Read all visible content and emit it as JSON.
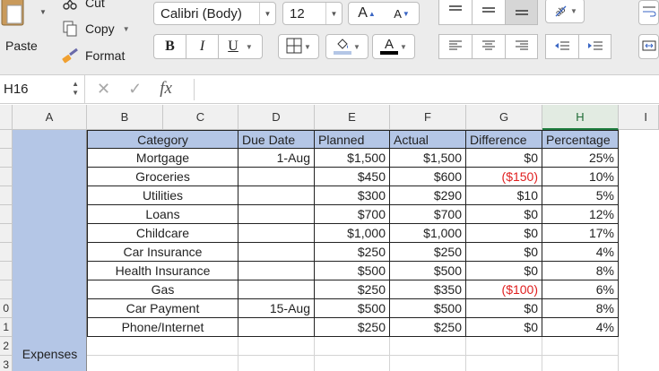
{
  "ribbon": {
    "paste_label": "Paste",
    "cut_label": "Cut",
    "copy_label": "Copy",
    "format_label": "Format",
    "font_name": "Calibri (Body)",
    "font_size": "12",
    "bold": "B",
    "italic": "I",
    "underline": "U",
    "grow_font": "A",
    "shrink_font": "A",
    "font_color_letter": "A",
    "font_color": "#000000",
    "fill_color": "#b4c6e6",
    "icons": [
      "paste-clipboard",
      "scissors",
      "copy-pages",
      "format-painter",
      "borders-grid",
      "fill-bucket",
      "orientation",
      "indent-decrease",
      "indent-increase",
      "wrap-text",
      "merge-center"
    ]
  },
  "formula_bar": {
    "name_box": "H16",
    "fx": "fx",
    "formula": ""
  },
  "columns": [
    "A",
    "B",
    "C",
    "D",
    "E",
    "F",
    "G",
    "H",
    "I"
  ],
  "selected_column": "H",
  "row_numbers": [
    "",
    "",
    "",
    "",
    "",
    "",
    "",
    "",
    "",
    "0",
    "1",
    "2",
    "3"
  ],
  "table": {
    "headers": {
      "category": "Category",
      "due_date": "Due Date",
      "planned": "Planned",
      "actual": "Actual",
      "difference": "Difference",
      "percentage": "Percentage"
    },
    "rows": [
      {
        "category": "Mortgage",
        "due": "1-Aug",
        "planned": "$1,500",
        "actual": "$1,500",
        "diff": "$0",
        "pct": "25%",
        "neg": false
      },
      {
        "category": "Groceries",
        "due": "",
        "planned": "$450",
        "actual": "$600",
        "diff": "($150)",
        "pct": "10%",
        "neg": true
      },
      {
        "category": "Utilities",
        "due": "",
        "planned": "$300",
        "actual": "$290",
        "diff": "$10",
        "pct": "5%",
        "neg": false
      },
      {
        "category": "Loans",
        "due": "",
        "planned": "$700",
        "actual": "$700",
        "diff": "$0",
        "pct": "12%",
        "neg": false
      },
      {
        "category": "Childcare",
        "due": "",
        "planned": "$1,000",
        "actual": "$1,000",
        "diff": "$0",
        "pct": "17%",
        "neg": false
      },
      {
        "category": "Car Insurance",
        "due": "",
        "planned": "$250",
        "actual": "$250",
        "diff": "$0",
        "pct": "4%",
        "neg": false
      },
      {
        "category": "Health Insurance",
        "due": "",
        "planned": "$500",
        "actual": "$500",
        "diff": "$0",
        "pct": "8%",
        "neg": false
      },
      {
        "category": "Gas",
        "due": "",
        "planned": "$250",
        "actual": "$350",
        "diff": "($100)",
        "pct": "6%",
        "neg": true
      },
      {
        "category": "Car Payment",
        "due": "15-Aug",
        "planned": "$500",
        "actual": "$500",
        "diff": "$0",
        "pct": "8%",
        "neg": false
      },
      {
        "category": "Phone/Internet",
        "due": "",
        "planned": "$250",
        "actual": "$250",
        "diff": "$0",
        "pct": "4%",
        "neg": false
      }
    ]
  },
  "section_label": "Expenses",
  "colors": {
    "header_fill": "#b4c6e6",
    "negative_text": "#e02020",
    "selected_header": "#1e7d3e"
  }
}
